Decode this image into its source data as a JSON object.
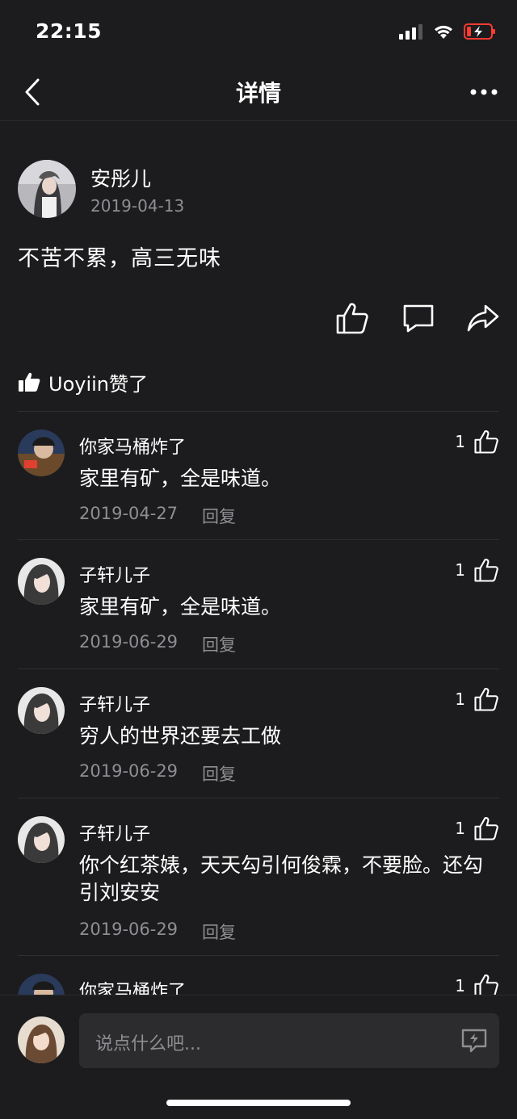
{
  "status_bar": {
    "time": "22:15"
  },
  "nav": {
    "title": "详情"
  },
  "post": {
    "author": "安彤儿",
    "date": "2019-04-13",
    "content": "不苦不累，高三无味"
  },
  "likes": {
    "text": "Uoyiin赞了"
  },
  "comments": [
    {
      "name": "你家马桶炸了",
      "text": "家里有矿，全是味道。",
      "date": "2019-04-27",
      "reply_label": "回复",
      "likes": "1"
    },
    {
      "name": "子轩儿子",
      "text": "家里有矿，全是味道。",
      "date": "2019-06-29",
      "reply_label": "回复",
      "likes": "1"
    },
    {
      "name": "子轩儿子",
      "text": "穷人的世界还要去工做",
      "date": "2019-06-29",
      "reply_label": "回复",
      "likes": "1"
    },
    {
      "name": "子轩儿子",
      "text": "你个红茶婊，天天勾引何俊霖，不要脸。还勾引刘安安",
      "date": "2019-06-29",
      "reply_label": "回复",
      "likes": "1"
    },
    {
      "name": "你家马桶炸了",
      "text": "",
      "date": "",
      "reply_label": "",
      "likes": "1"
    }
  ],
  "input": {
    "placeholder": "说点什么吧..."
  },
  "icons": {
    "back": "chevron-left-icon",
    "more": "more-dots-icon",
    "like": "thumbs-up-icon",
    "comment": "comment-bubble-icon",
    "share": "share-arrow-icon",
    "emoji": "emoji-keyboard-icon"
  },
  "colors": {
    "background": "#1c1c1e",
    "secondary_text": "#8e8e93",
    "input_bg": "#2c2c2e",
    "battery_low": "#ff3b30"
  }
}
